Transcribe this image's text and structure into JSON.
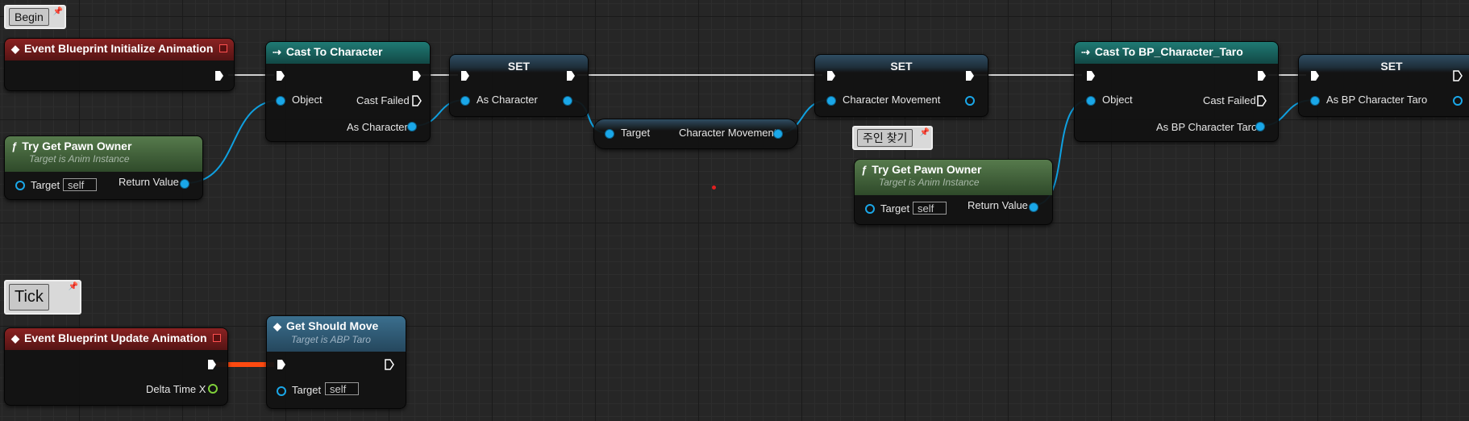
{
  "comments": {
    "begin": "Begin",
    "find_owner": "주인 찾기",
    "tick": "Tick"
  },
  "nodes": {
    "init_event": {
      "title": "Event Blueprint Initialize Animation"
    },
    "try_pawn_1": {
      "title": "Try Get Pawn Owner",
      "subtitle": "Target is Anim Instance",
      "target_label": "Target",
      "target_value": "self",
      "return_label": "Return Value"
    },
    "cast_char": {
      "title": "Cast To Character",
      "object_label": "Object",
      "cast_failed_label": "Cast Failed",
      "as_label": "As Character"
    },
    "set_1": {
      "title": "SET",
      "pin_label": "As Character"
    },
    "get_char_movement": {
      "target_label": "Target",
      "output_label": "Character Movement"
    },
    "set_2": {
      "title": "SET",
      "pin_label": "Character Movement"
    },
    "try_pawn_2": {
      "title": "Try Get Pawn Owner",
      "subtitle": "Target is Anim Instance",
      "target_label": "Target",
      "target_value": "self",
      "return_label": "Return Value"
    },
    "cast_taro": {
      "title": "Cast To BP_Character_Taro",
      "object_label": "Object",
      "cast_failed_label": "Cast Failed",
      "as_label": "As BP Character Taro"
    },
    "set_3": {
      "title": "SET",
      "pin_label": "As BP Character Taro"
    },
    "update_event": {
      "title": "Event Blueprint Update Animation",
      "delta_label": "Delta Time X"
    },
    "get_should_move": {
      "title": "Get Should Move",
      "subtitle": "Target is ABP Taro",
      "target_label": "Target",
      "target_value": "self"
    }
  },
  "icons": {
    "event": "event-diamond-icon",
    "cast": "cast-arrow-icon",
    "function": "function-f-icon"
  },
  "colors": {
    "exec_wire": "#d8d8d8",
    "object_wire": "#0fa0e0",
    "active_exec_wire": "#ff4a10",
    "event_header": "#8a2222",
    "cast_header": "#1f7a74",
    "pure_header": "#567a4c"
  }
}
